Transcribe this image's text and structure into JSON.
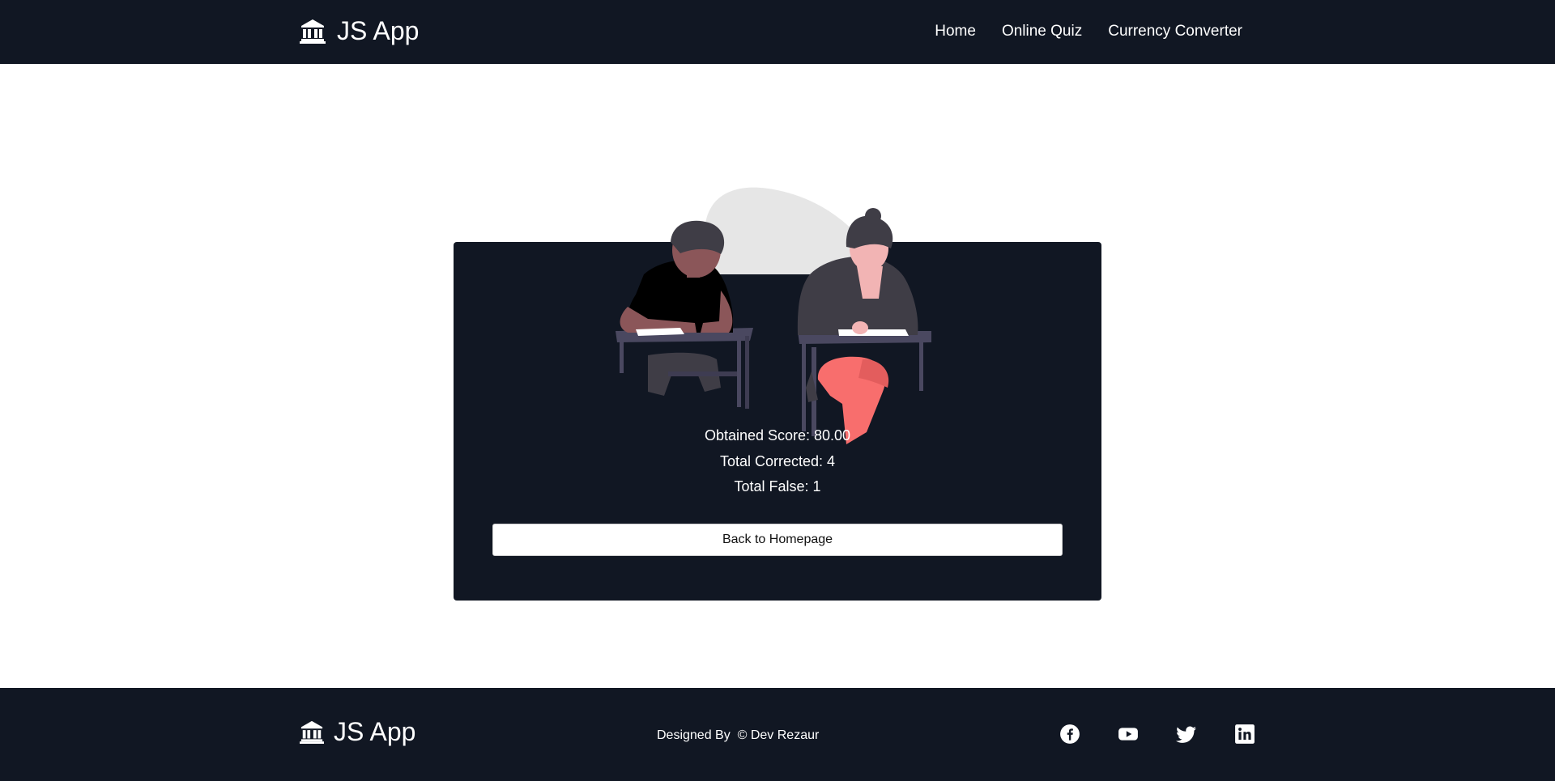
{
  "header": {
    "brand": "JS App",
    "nav": [
      {
        "label": "Home"
      },
      {
        "label": "Online Quiz"
      },
      {
        "label": "Currency Converter"
      }
    ]
  },
  "result": {
    "score_text": "Obtained Score: 80.00",
    "correct_text": "Total Corrected: 4",
    "false_text": "Total False: 1",
    "button_label": "Back to Homepage"
  },
  "footer": {
    "brand": "JS App",
    "credit": "Designed By  © Dev Rezaur",
    "socials": [
      "facebook-icon",
      "youtube-icon",
      "twitter-icon",
      "linkedin-icon"
    ]
  },
  "colors": {
    "dark": "#111723",
    "accent": "#f86e6d"
  }
}
